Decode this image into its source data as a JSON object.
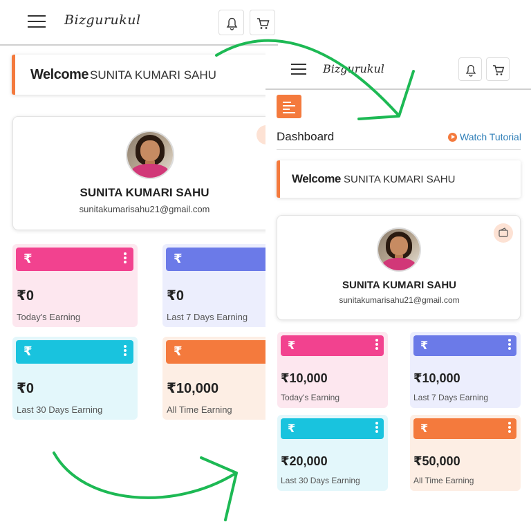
{
  "brand": {
    "logo_text": "Bizgurukul",
    "accent": "#f47a3d"
  },
  "before": {
    "welcome": {
      "prefix": "Welcome",
      "name": "SUNITA KUMARI SAHU"
    },
    "profile": {
      "name": "SUNITA KUMARI SAHU",
      "email": "sunitakumarisahu21@gmail.com"
    },
    "cards": [
      {
        "symbol": "₹",
        "amount": "₹0",
        "label": "Today's Earning",
        "color": "#f2428f",
        "bg": "#fde7ef"
      },
      {
        "symbol": "₹",
        "amount": "₹0",
        "label": "Last 7 Days Earning",
        "color": "#6b7ae8",
        "bg": "#eceefd"
      },
      {
        "symbol": "₹",
        "amount": "₹0",
        "label": "Last 30 Days Earning",
        "color": "#19c3de",
        "bg": "#e3f7fb"
      },
      {
        "symbol": "₹",
        "amount": "₹10,000",
        "label": "All Time Earning",
        "color": "#f47a3d",
        "bg": "#fdeee4"
      }
    ]
  },
  "after": {
    "page_title": "Dashboard",
    "watch_tutorial": "Watch Tutorial",
    "welcome": {
      "prefix": "Welcome",
      "name": "SUNITA KUMARI SAHU"
    },
    "profile": {
      "name": "SUNITA KUMARI SAHU",
      "email": "sunitakumarisahu21@gmail.com"
    },
    "cards": [
      {
        "symbol": "₹",
        "amount": "₹10,000",
        "label": "Today's Earning",
        "color": "#f2428f",
        "bg": "#fde7ef"
      },
      {
        "symbol": "₹",
        "amount": "₹10,000",
        "label": "Last 7 Days Earning",
        "color": "#6b7ae8",
        "bg": "#eceefd"
      },
      {
        "symbol": "₹",
        "amount": "₹20,000",
        "label": "Last 30 Days Earning",
        "color": "#19c3de",
        "bg": "#e3f7fb"
      },
      {
        "symbol": "₹",
        "amount": "₹50,000",
        "label": "All Time Earning",
        "color": "#f47a3d",
        "bg": "#fdeee4"
      }
    ]
  },
  "arrow_color": "#1db954"
}
